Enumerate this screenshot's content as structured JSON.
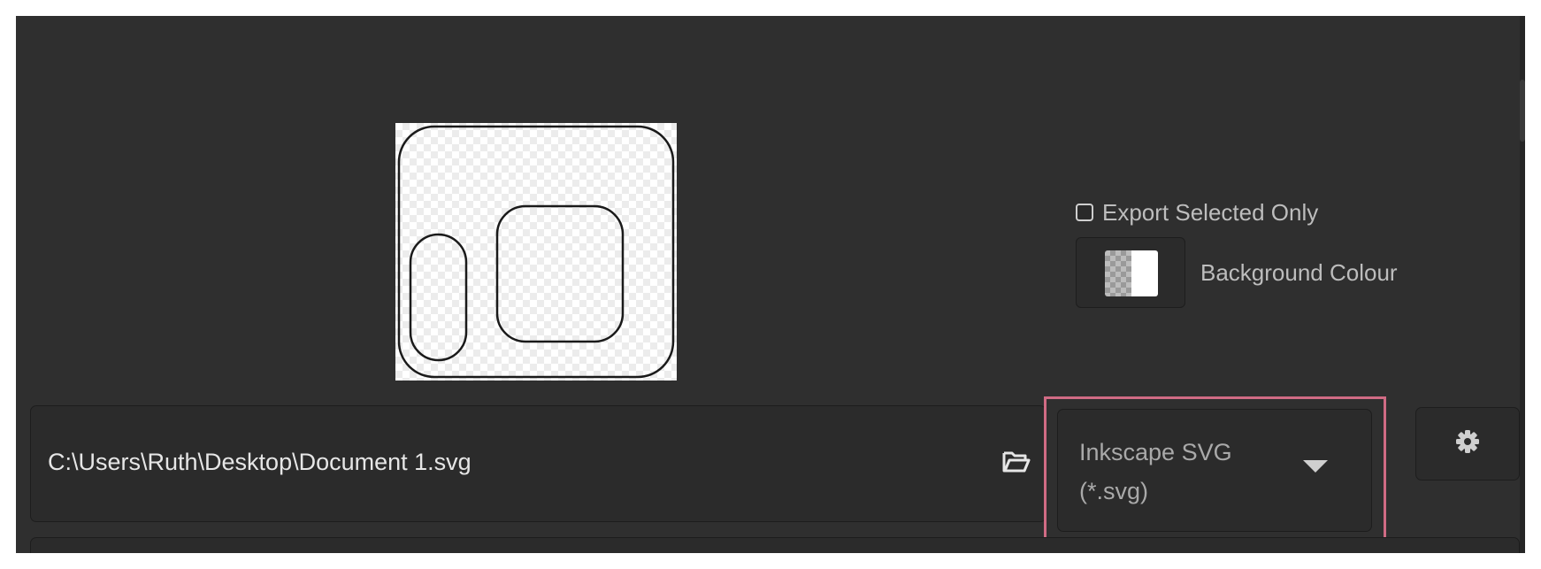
{
  "options": {
    "export_selected_only": {
      "label": "Export Selected Only",
      "checked": false
    },
    "background_colour": {
      "label": "Background Colour"
    }
  },
  "file": {
    "path": "C:\\Users\\Ruth\\Desktop\\Document 1.svg",
    "open_icon": "folder-open-icon"
  },
  "format": {
    "selected": "Inkscape SVG (*.svg)",
    "line1": "Inkscape SVG",
    "line2": "(*.svg)",
    "highlight_color": "#d06b84"
  },
  "settings": {
    "icon": "gear-icon"
  },
  "colors": {
    "panel_bg": "#2f2f2f",
    "field_bg": "#2b2b2b",
    "label_text": "#bdbdbd",
    "path_text": "#e6e6e6",
    "highlight": "#d06b84"
  }
}
